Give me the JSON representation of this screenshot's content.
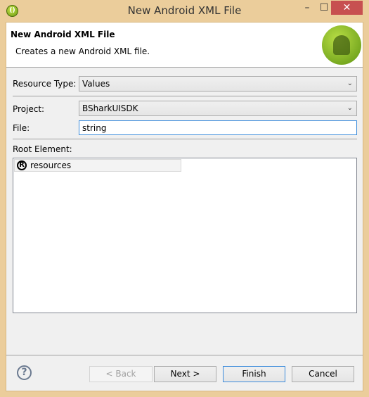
{
  "window": {
    "title": "New Android XML File",
    "minimize": "–",
    "maximize": "☐",
    "close": "✕",
    "app_icon": "android-eclipse-icon"
  },
  "header": {
    "title": "New Android XML File",
    "description": "Creates a new Android XML file.",
    "logo": "android-logo"
  },
  "form": {
    "resource_type": {
      "label": "Resource Type:",
      "value": "Values"
    },
    "project": {
      "label": "Project:",
      "value": "BSharkUISDK"
    },
    "file": {
      "label": "File:",
      "value": "string"
    },
    "root_element": {
      "label": "Root Element:",
      "items": [
        {
          "icon": "R",
          "label": "resources"
        }
      ]
    }
  },
  "buttons": {
    "help": "?",
    "back": "< Back",
    "next": "Next >",
    "finish": "Finish",
    "cancel": "Cancel"
  }
}
